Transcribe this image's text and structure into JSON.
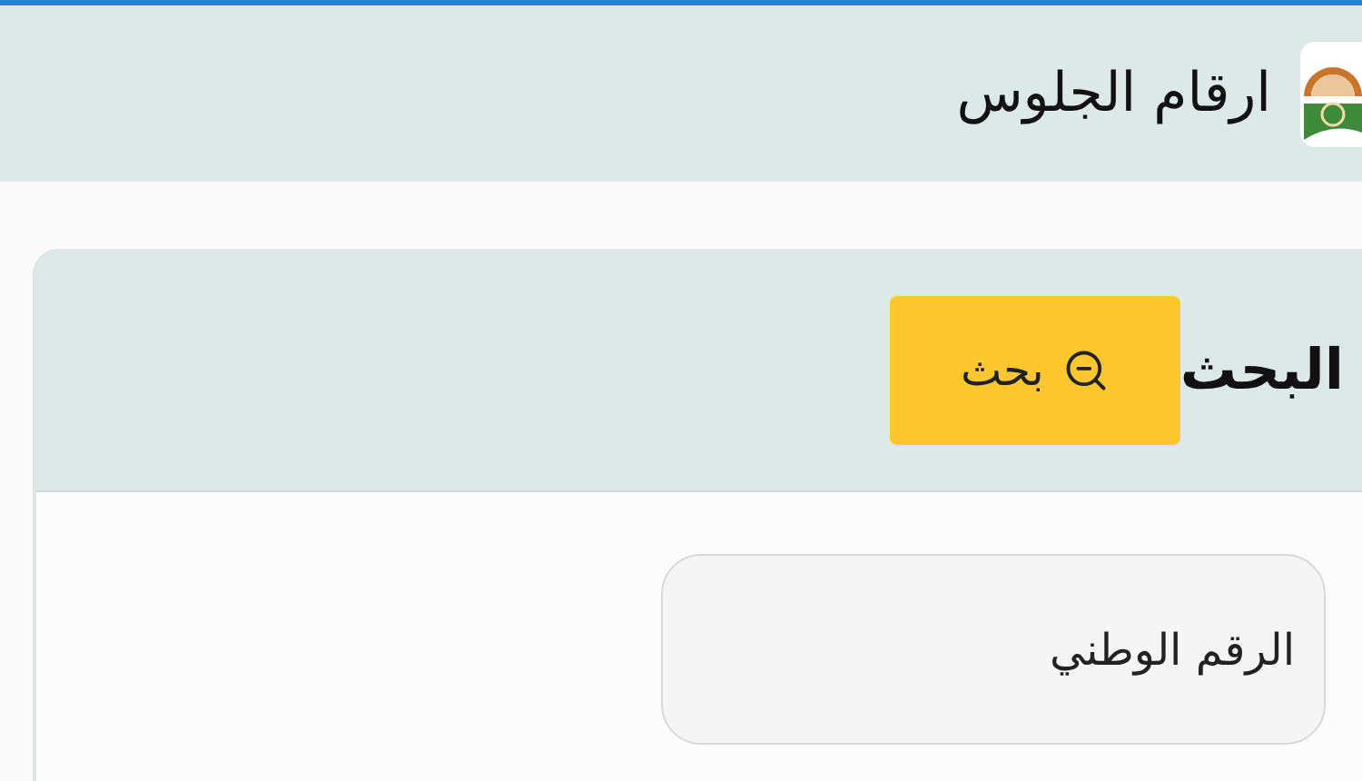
{
  "header": {
    "title": "ارقام الجلوس"
  },
  "search_card": {
    "title": "البحث",
    "button": "بحث"
  },
  "form": {
    "fields": [
      {
        "placeholder": "الرقم الوطني"
      }
    ]
  }
}
